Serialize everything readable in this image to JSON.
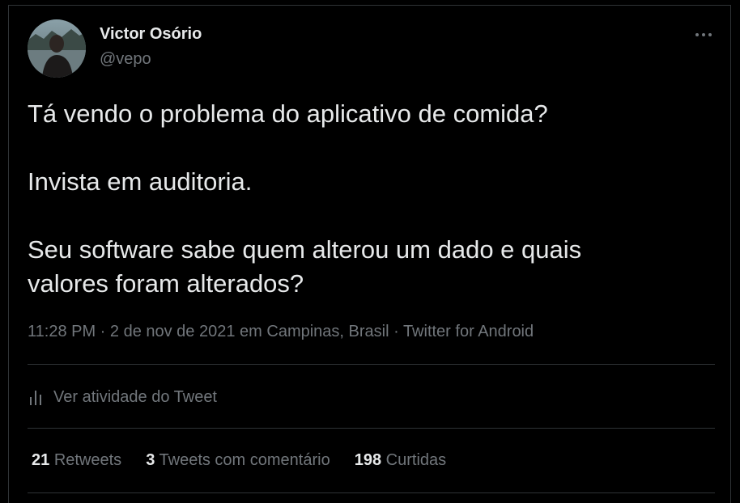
{
  "author": {
    "name": "Victor Osório",
    "handle": "@vepo"
  },
  "tweet": {
    "paragraphs": [
      "Tá vendo o problema do aplicativo de comida?",
      "Invista em auditoria.",
      "Seu software sabe quem alterou um dado e quais",
      "valores foram alterados?"
    ],
    "meta": "11:28 PM · 2 de nov de 2021 em Campinas, Brasil · Twitter for Android"
  },
  "activity": {
    "label": "Ver atividade do Tweet",
    "icon": "analytics-icon"
  },
  "stats": {
    "retweets": {
      "count": "21",
      "label": "Retweets"
    },
    "quotes": {
      "count": "3",
      "label": "Tweets com comentário"
    },
    "likes": {
      "count": "198",
      "label": "Curtidas"
    }
  },
  "colors": {
    "background": "#000000",
    "primary_text": "#e7e9ea",
    "secondary_text": "#71767b",
    "divider": "#2f3336"
  }
}
